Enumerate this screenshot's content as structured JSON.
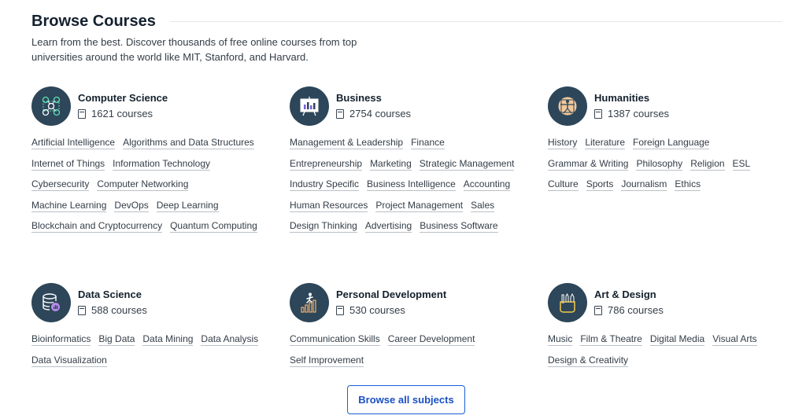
{
  "header": {
    "title": "Browse Courses",
    "subtitle": "Learn from the best. Discover thousands of free online courses from top universities around the world like MIT, Stanford, and Harvard."
  },
  "categories": [
    {
      "name": "Computer Science",
      "count": "1621 courses",
      "icon": "network-diagram-icon",
      "links": [
        "Artificial Intelligence",
        "Algorithms and Data Structures",
        "Internet of Things",
        "Information Technology",
        "Cybersecurity",
        "Computer Networking",
        "Machine Learning",
        "DevOps",
        "Deep Learning",
        "Blockchain and Cryptocurrency",
        "Quantum Computing"
      ]
    },
    {
      "name": "Business",
      "count": "2754 courses",
      "icon": "presentation-board-icon",
      "links": [
        "Management & Leadership",
        "Finance",
        "Entrepreneurship",
        "Marketing",
        "Strategic Management",
        "Industry Specific",
        "Business Intelligence",
        "Accounting",
        "Human Resources",
        "Project Management",
        "Sales",
        "Design Thinking",
        "Advertising",
        "Business Software"
      ]
    },
    {
      "name": "Humanities",
      "count": "1387 courses",
      "icon": "vitruvian-man-icon",
      "links": [
        "History",
        "Literature",
        "Foreign Language",
        "Grammar & Writing",
        "Philosophy",
        "Religion",
        "ESL",
        "Culture",
        "Sports",
        "Journalism",
        "Ethics"
      ]
    },
    {
      "name": "Data Science",
      "count": "588 courses",
      "icon": "database-chart-icon",
      "links": [
        "Bioinformatics",
        "Big Data",
        "Data Mining",
        "Data Analysis",
        "Data Visualization"
      ]
    },
    {
      "name": "Personal Development",
      "count": "530 courses",
      "icon": "climbing-bars-icon",
      "links": [
        "Communication Skills",
        "Career Development",
        "Self Improvement"
      ]
    },
    {
      "name": "Art & Design",
      "count": "786 courses",
      "icon": "pencil-cup-icon",
      "links": [
        "Music",
        "Film & Theatre",
        "Digital Media",
        "Visual Arts",
        "Design & Creativity"
      ]
    }
  ],
  "browse_all_label": "Browse all subjects",
  "colors": {
    "icon_bg": "#2d4659",
    "accent_blue": "#1a5fd6",
    "title": "#14212e"
  }
}
